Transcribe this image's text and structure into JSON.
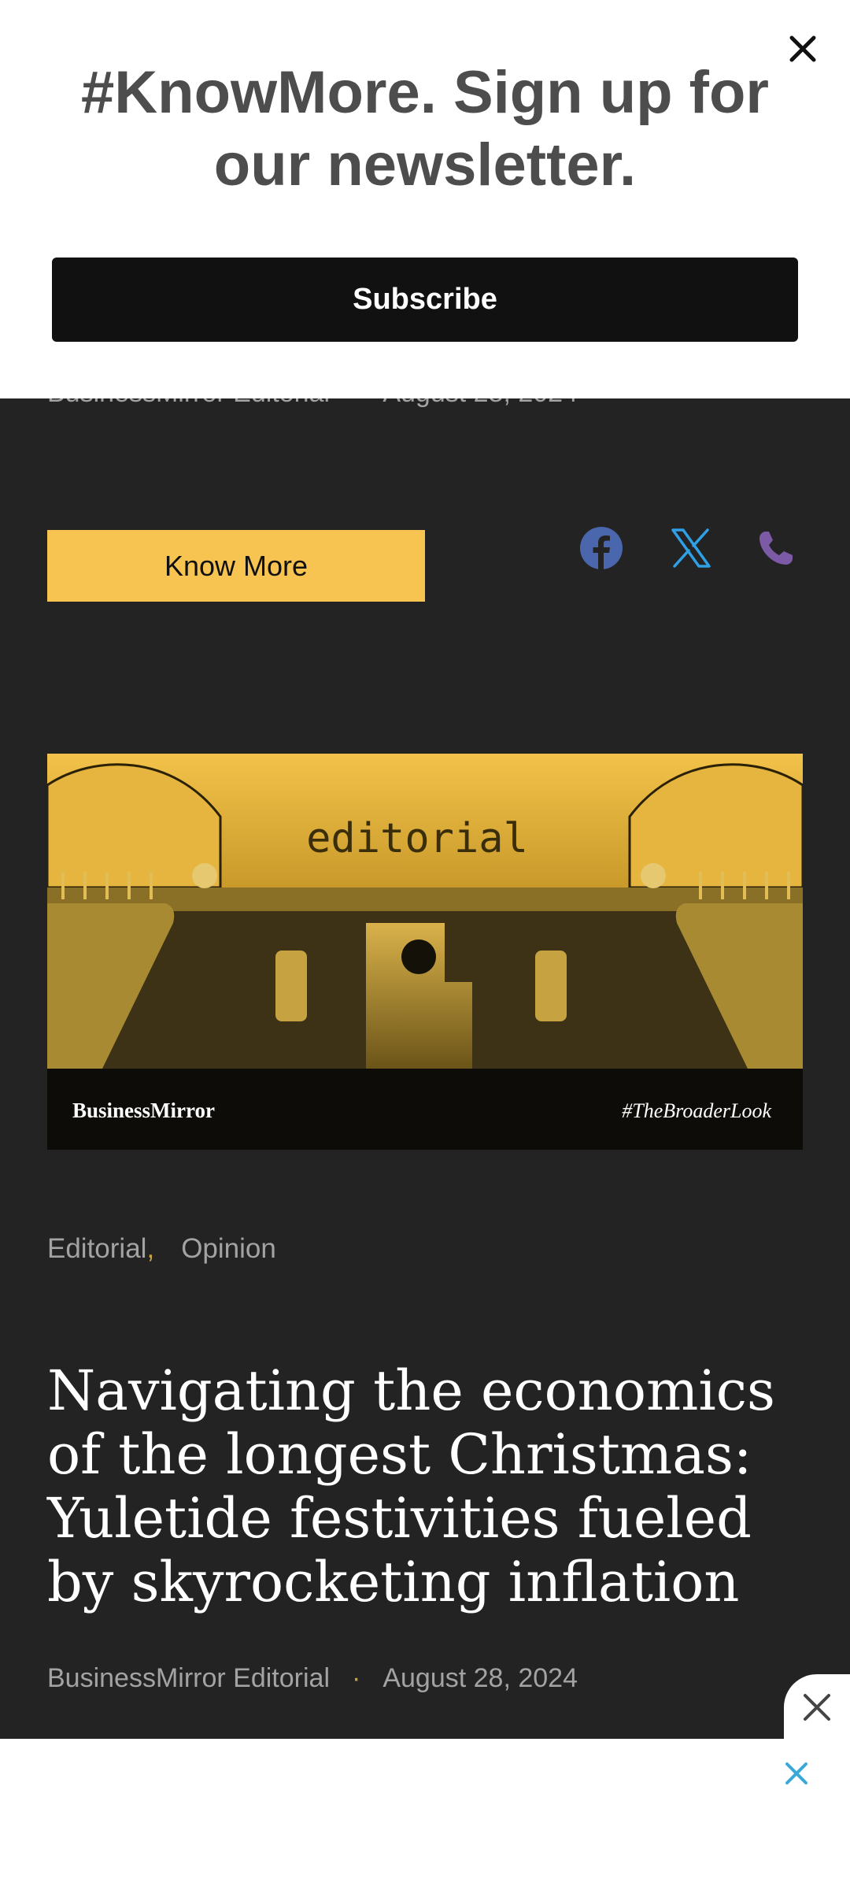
{
  "popup": {
    "title": "#KnowMore. Sign up for our newsletter.",
    "subscribe_label": "Subscribe",
    "close_icon": "close-icon"
  },
  "article_meta": {
    "author": "BusinessMirror Editorial",
    "separator": "·",
    "date": "August 28, 2024"
  },
  "actions": {
    "know_more_label": "Know More",
    "share_icons": [
      "facebook-icon",
      "x-twitter-icon",
      "phone-icon"
    ]
  },
  "hero_image": {
    "typed_word": "editorial",
    "brand": "BusinessMirror",
    "hashtag": "#TheBroaderLook"
  },
  "categories": [
    {
      "label": "Editorial"
    },
    {
      "label": "Opinion"
    }
  ],
  "categories_separator": ",",
  "headline": "Navigating the economics of the longest Christmas: Yuletide festivities fueled by skyrocketing inflation",
  "colors": {
    "page_bg": "#232323",
    "accent_yellow": "#f7c452",
    "facebook_blue": "#4a66ad",
    "x_blue": "#2fa0e6",
    "phone_purple": "#7c5aa6",
    "ad_close_blue": "#3aa8d8"
  }
}
